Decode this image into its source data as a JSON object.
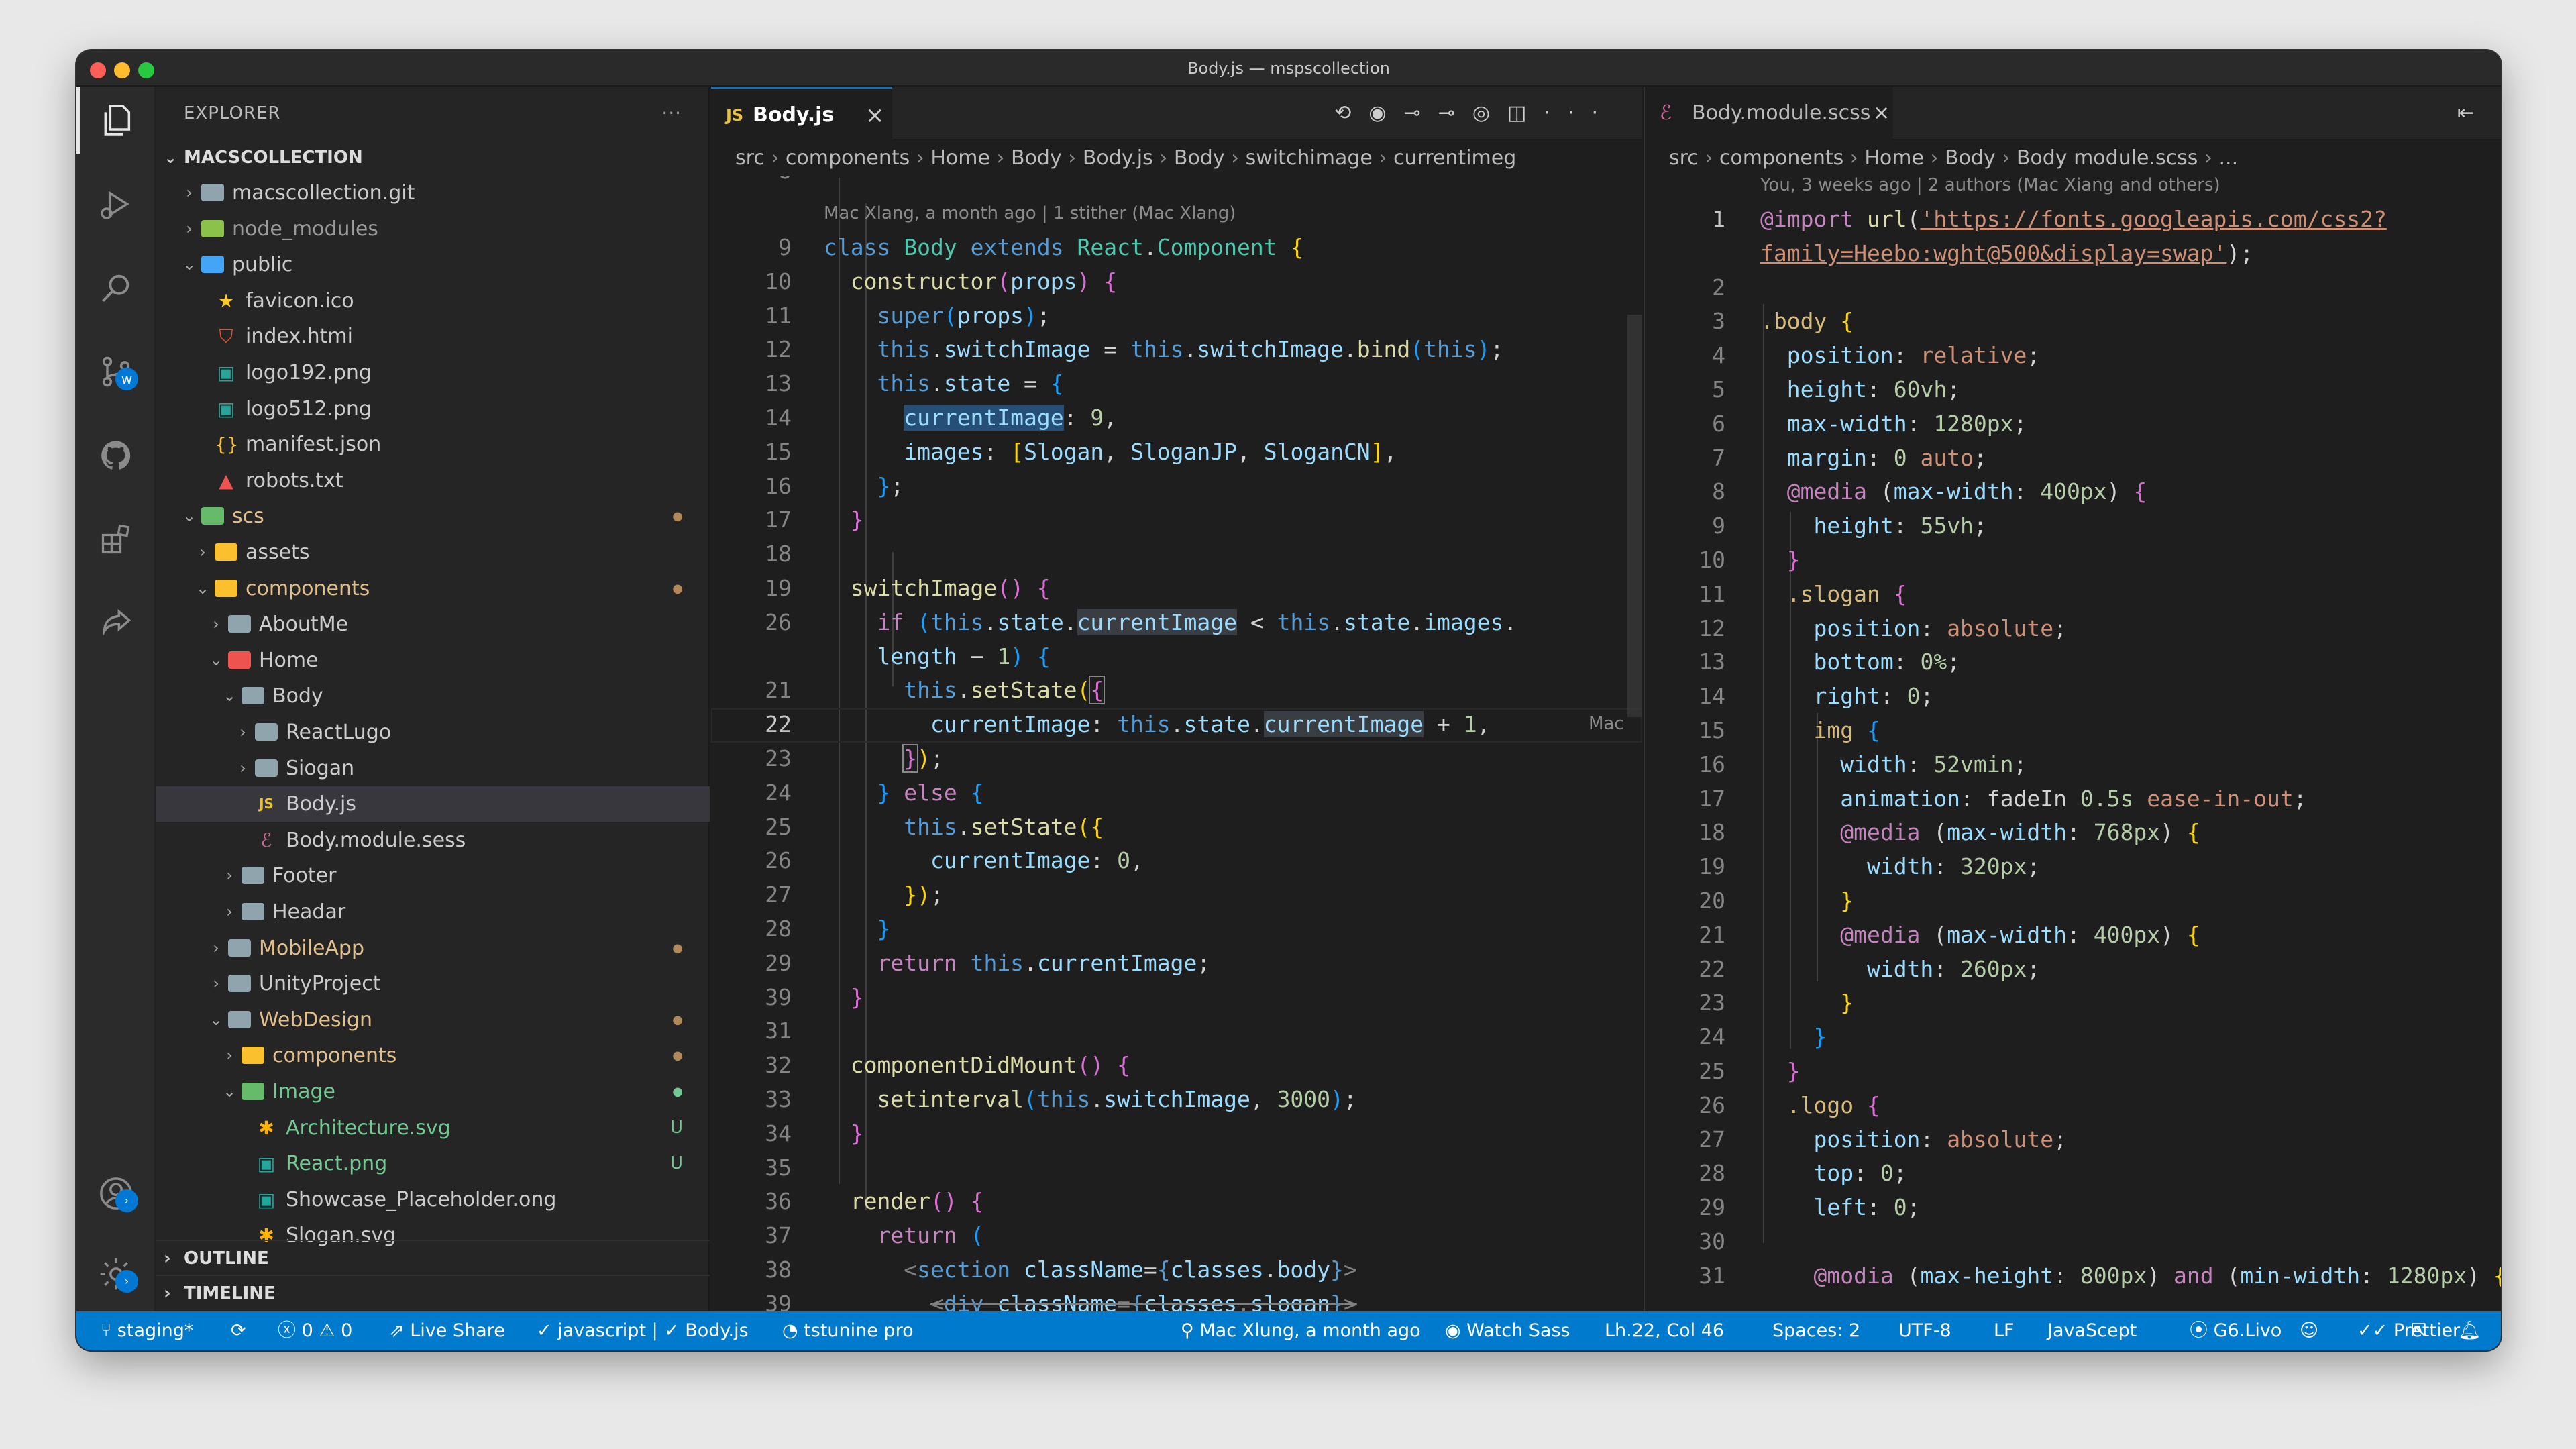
{
  "window": {
    "title": "Body.js — mspscollection"
  },
  "activity_bar": {
    "icons": [
      "files-icon",
      "run-debug-icon",
      "search-icon",
      "source-control-icon",
      "github-icon",
      "extensions-icon",
      "live-share-icon",
      "account-icon",
      "settings-gear-icon"
    ],
    "source_control_badge": "w"
  },
  "explorer": {
    "header": "EXPLORER",
    "more": "···",
    "root": "MACSCOLLECTION",
    "items": [
      {
        "label": "macscollection.git",
        "depth": 1,
        "type": "folder",
        "open": false,
        "color": "#cccccc",
        "status": ""
      },
      {
        "label": "node_modules",
        "depth": 1,
        "type": "folder-node",
        "open": false,
        "color": "#9a9a9a",
        "status": ""
      },
      {
        "label": "public",
        "depth": 1,
        "type": "folder-blue",
        "open": true,
        "color": "#cccccc",
        "status": ""
      },
      {
        "label": "favicon.ico",
        "depth": 2,
        "type": "star",
        "color": "#cccccc",
        "status": ""
      },
      {
        "label": "index.htmi",
        "depth": 2,
        "type": "html",
        "color": "#cccccc",
        "status": ""
      },
      {
        "label": "logo192.png",
        "depth": 2,
        "type": "image",
        "color": "#cccccc",
        "status": ""
      },
      {
        "label": "logo512.png",
        "depth": 2,
        "type": "image",
        "color": "#cccccc",
        "status": ""
      },
      {
        "label": "manifest.json",
        "depth": 2,
        "type": "json",
        "color": "#cccccc",
        "status": ""
      },
      {
        "label": "robots.txt",
        "depth": 2,
        "type": "robot",
        "color": "#cccccc",
        "status": ""
      },
      {
        "label": "scs",
        "depth": 1,
        "type": "folder-green",
        "open": true,
        "color": "#e2c08d",
        "status": "dot"
      },
      {
        "label": "assets",
        "depth": 2,
        "type": "folder-yellow",
        "open": false,
        "color": "#cccccc",
        "status": ""
      },
      {
        "label": "components",
        "depth": 2,
        "type": "folder-yellow",
        "open": true,
        "color": "#e2c08d",
        "status": "dot"
      },
      {
        "label": "AboutMe",
        "depth": 3,
        "type": "folder",
        "open": false,
        "color": "#cccccc",
        "status": ""
      },
      {
        "label": "Home",
        "depth": 3,
        "type": "folder-red",
        "open": true,
        "color": "#cccccc",
        "status": ""
      },
      {
        "label": "Body",
        "depth": 4,
        "type": "folder",
        "open": true,
        "color": "#cccccc",
        "status": ""
      },
      {
        "label": "ReactLugo",
        "depth": 5,
        "type": "folder",
        "open": false,
        "color": "#cccccc",
        "status": ""
      },
      {
        "label": "Siogan",
        "depth": 5,
        "type": "folder",
        "open": false,
        "color": "#cccccc",
        "status": ""
      },
      {
        "label": "Body.js",
        "depth": 5,
        "type": "js",
        "color": "#cccccc",
        "status": "",
        "selected": true
      },
      {
        "label": "Body.module.sess",
        "depth": 5,
        "type": "sass",
        "color": "#cccccc",
        "status": ""
      },
      {
        "label": "Footer",
        "depth": 4,
        "type": "folder",
        "open": false,
        "color": "#cccccc",
        "status": ""
      },
      {
        "label": "Headar",
        "depth": 4,
        "type": "folder",
        "open": false,
        "color": "#cccccc",
        "status": ""
      },
      {
        "label": "MobileApp",
        "depth": 3,
        "type": "folder",
        "open": false,
        "color": "#e2c08d",
        "status": "dot"
      },
      {
        "label": "UnityProject",
        "depth": 3,
        "type": "folder",
        "open": false,
        "color": "#cccccc",
        "status": ""
      },
      {
        "label": "WebDesign",
        "depth": 3,
        "type": "folder",
        "open": true,
        "color": "#e2c08d",
        "status": "dot"
      },
      {
        "label": "components",
        "depth": 4,
        "type": "folder-yellow",
        "open": false,
        "color": "#e2c08d",
        "status": "dot"
      },
      {
        "label": "Image",
        "depth": 4,
        "type": "folder-green",
        "open": true,
        "color": "#73c991",
        "status": "dotg"
      },
      {
        "label": "Architecture.svg",
        "depth": 5,
        "type": "svg",
        "color": "#73c991",
        "status": "U"
      },
      {
        "label": "React.png",
        "depth": 5,
        "type": "image",
        "color": "#73c991",
        "status": "U"
      },
      {
        "label": "Showcase_Placeholder.ong",
        "depth": 5,
        "type": "image",
        "color": "#cccccc",
        "status": ""
      },
      {
        "label": "Slogan.svg",
        "depth": 5,
        "type": "svg",
        "color": "#cccccc",
        "status": ""
      }
    ],
    "sections": [
      "OUTLINE",
      "TIMELINE"
    ]
  },
  "left_editor": {
    "tab": "Body.js",
    "tab_close": "×",
    "toolbar_more": "···",
    "breadcrumb": [
      "src",
      "components",
      "Home",
      "Body",
      "Body.js",
      "Body",
      "switchimage",
      "currentimeg"
    ],
    "blame": "Mac Xlang, a month ago | 1 stither (Mac Xlang)",
    "inline_blame": "Mac",
    "line_numbers": [
      "9",
      "10",
      "11",
      "12",
      "13",
      "14",
      "15",
      "16",
      "17",
      "18",
      "19",
      "26",
      "",
      "21",
      "22",
      "23",
      "24",
      "25",
      "26",
      "27",
      "28",
      "29",
      "39",
      "31",
      "32",
      "33",
      "34",
      "35",
      "36",
      "37",
      "38",
      "39"
    ],
    "top_partial_line": "8"
  },
  "right_editor": {
    "tab": "Body.module.scss",
    "tab_close": "×",
    "breadcrumb": [
      "src",
      "components",
      "Home",
      "Body",
      "Body module.scss",
      "..."
    ],
    "blame": "You, 3 weeks ago | 2 authors (Mac Xiang and others)",
    "line_numbers": [
      "1",
      "",
      "2",
      "3",
      "4",
      "5",
      "6",
      "7",
      "8",
      "9",
      "10",
      "11",
      "12",
      "13",
      "14",
      "15",
      "16",
      "17",
      "18",
      "19",
      "20",
      "21",
      "22",
      "23",
      "24",
      "25",
      "26",
      "27",
      "28",
      "29",
      "30",
      "31"
    ]
  },
  "status_bar": {
    "branch": "staging*",
    "errors": "0",
    "warnings": "0",
    "live_share": "Live Share",
    "lang_check": "javascript |",
    "file_check": "Body.js",
    "tabnine": "tstunine pro",
    "blame": "Mac Xlung, a month ago",
    "watch_sass": "Watch Sass",
    "position": "Lh.22, Col 46",
    "spaces": "Spaces: 2",
    "encoding": "UTF-8",
    "eol": "LF",
    "language": "JavaScept",
    "golive": "G6.Livo",
    "prettier": "Prettier"
  }
}
